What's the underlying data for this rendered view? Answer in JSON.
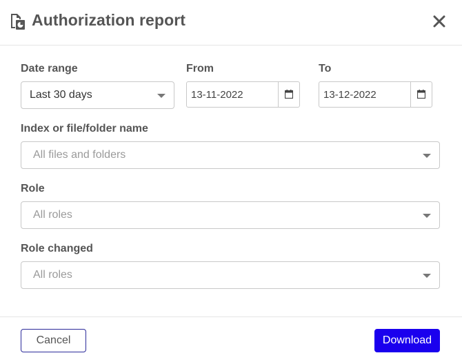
{
  "dialog": {
    "title": "Authorization report",
    "header_icon": "report-icon",
    "close_icon": "close-icon"
  },
  "form": {
    "date_range": {
      "label": "Date range",
      "value": "Last 30 days"
    },
    "from": {
      "label": "From",
      "value": "13-11-2022",
      "icon": "calendar-icon"
    },
    "to": {
      "label": "To",
      "value": "13-12-2022",
      "icon": "calendar-icon"
    },
    "index": {
      "label": "Index or file/folder name",
      "placeholder": "All files and folders"
    },
    "role": {
      "label": "Role",
      "placeholder": "All roles"
    },
    "role_changed": {
      "label": "Role changed",
      "placeholder": "All roles"
    }
  },
  "footer": {
    "cancel_label": "Cancel",
    "download_label": "Download"
  },
  "colors": {
    "primary": "#1a00ee",
    "cancel_border": "#2b2a9a",
    "label": "#555555",
    "border": "#c8c8c8"
  }
}
